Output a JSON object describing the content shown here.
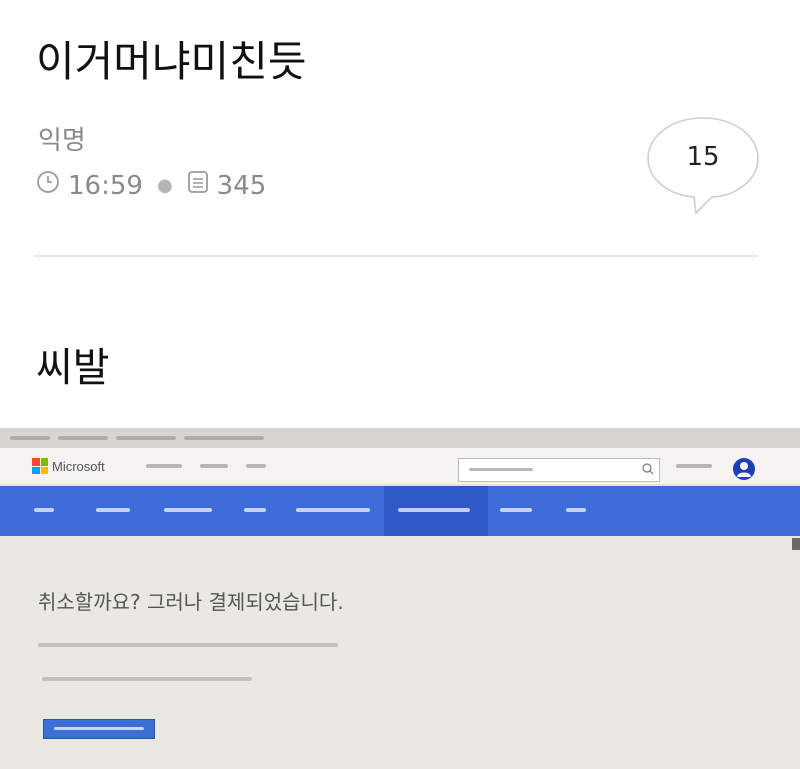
{
  "post": {
    "title": "이거머냐미친듯",
    "author": "익명",
    "time": "16:59",
    "views": "345",
    "comment_count": "15",
    "body": "씨발"
  },
  "icons": {
    "time": "clock-icon",
    "views": "document-icon",
    "comments": "speech-bubble-icon"
  },
  "screenshot": {
    "brand": "Microsoft",
    "heading": "취소할까요? 그러나 결제되었습니다.",
    "colors": {
      "nav_blue": "#3d6cd8",
      "avatar_blue": "#1d3fb8",
      "button_blue": "#3c6fd6"
    }
  }
}
